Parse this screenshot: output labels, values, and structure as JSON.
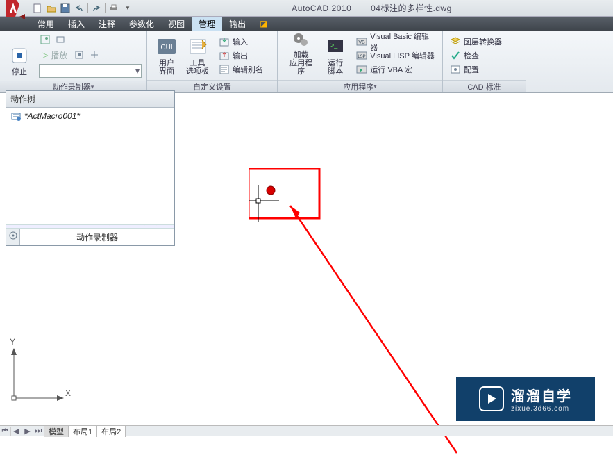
{
  "title": {
    "app": "AutoCAD 2010",
    "doc": "04标注的多样性.dwg"
  },
  "menu": {
    "tabs": [
      "常用",
      "插入",
      "注释",
      "参数化",
      "视图",
      "管理",
      "输出"
    ],
    "activeIndex": 5
  },
  "ribbon": {
    "p0": {
      "stop": "停止",
      "play": "播放",
      "label": "动作录制器"
    },
    "p1": {
      "cui": "用户\n界面",
      "tools": "工具\n选项板",
      "import": "输入",
      "export": "输出",
      "alias": "编辑别名",
      "label": "自定义设置"
    },
    "p2": {
      "load": "加载\n应用程序",
      "script": "运行\n脚本",
      "vb": "Visual Basic 编辑器",
      "vl": "Visual LISP 编辑器",
      "vba": "运行 VBA 宏",
      "label": "应用程序"
    },
    "p3": {
      "layer": "图层转换器",
      "check": "检查",
      "config": "配置",
      "label": "CAD 标准"
    }
  },
  "tree": {
    "title": "动作树",
    "item": "*ActMacro001*",
    "footer": "动作录制器"
  },
  "sheets": {
    "tabs": [
      "模型",
      "布局1",
      "布局2"
    ]
  },
  "ucs": {
    "x": "X",
    "y": "Y"
  },
  "watermark": {
    "brand": "溜溜自学",
    "domain": "zixue.3d66.com"
  }
}
